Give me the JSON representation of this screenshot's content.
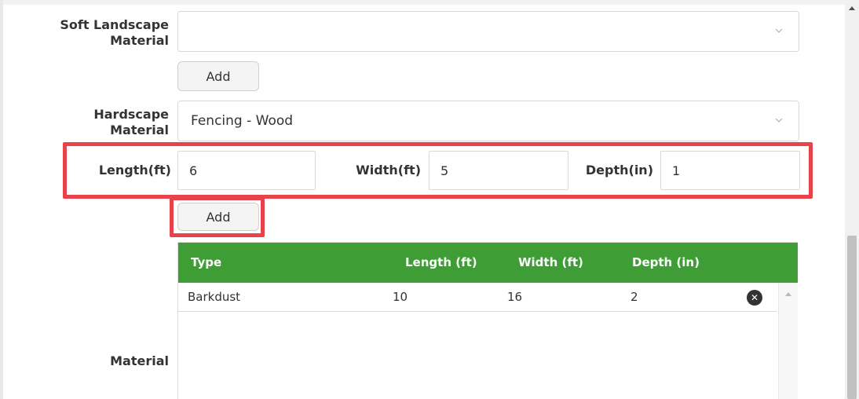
{
  "soft_landscape": {
    "label_line1": "Soft Landscape",
    "label_line2": "Material",
    "value": "",
    "add_label": "Add"
  },
  "hardscape": {
    "label_line1": "Hardscape",
    "label_line2": "Material",
    "value": "Fencing - Wood"
  },
  "dimensions": {
    "length_label": "Length(ft)",
    "length_value": "6",
    "width_label": "Width(ft)",
    "width_value": "5",
    "depth_label": "Depth(in)",
    "depth_value": "1",
    "add_label": "Add"
  },
  "material": {
    "label": "Material",
    "table": {
      "headers": [
        "Type",
        "Length (ft)",
        "Width (ft)",
        "Depth (in)"
      ],
      "rows": [
        [
          "Barkdust",
          "10",
          "16",
          "2"
        ]
      ],
      "remove_icon": "close-icon"
    }
  },
  "colors": {
    "header_green": "#3e9e35",
    "highlight_red": "#e8424a"
  }
}
